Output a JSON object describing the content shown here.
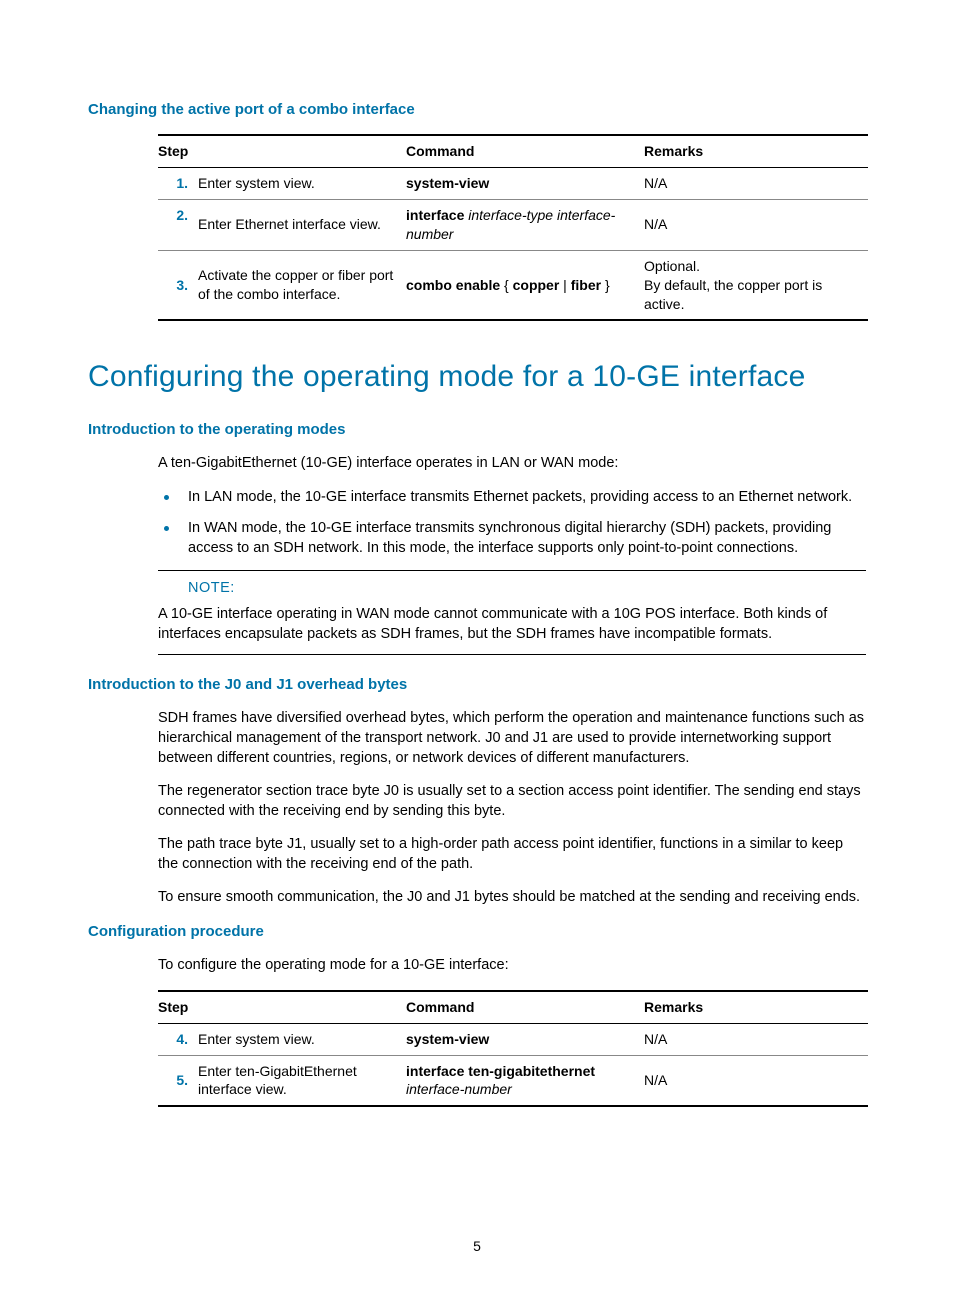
{
  "section1": {
    "title": "Changing the active port of a combo interface",
    "table": {
      "headers": {
        "step": "Step",
        "command": "Command",
        "remarks": "Remarks"
      },
      "rows": [
        {
          "num": "1.",
          "step": "Enter system view.",
          "cmd_bold": "system-view",
          "cmd_italic": "",
          "remarks": "N/A"
        },
        {
          "num": "2.",
          "step": "Enter Ethernet interface view.",
          "cmd_bold": "interface",
          "cmd_italic": "interface-type interface-number",
          "remarks": "N/A"
        },
        {
          "num": "3.",
          "step": "Activate the copper or fiber port of the combo interface.",
          "cmd_full": "combo enable { copper | fiber }",
          "remarks_line1": "Optional.",
          "remarks_line2": "By default, the copper port is active."
        }
      ]
    }
  },
  "section2": {
    "title": "Configuring the operating mode for a 10-GE interface",
    "sub1": {
      "title": "Introduction to the operating modes",
      "intro": "A ten-GigabitEthernet (10-GE) interface operates in LAN or WAN mode:",
      "bullets": [
        "In LAN mode, the 10-GE interface transmits Ethernet packets, providing access to an Ethernet network.",
        "In WAN mode, the 10-GE interface transmits synchronous digital hierarchy (SDH) packets, providing access to an SDH network. In this mode, the interface supports only point-to-point connections."
      ],
      "note_label": "NOTE:",
      "note_text": "A 10-GE interface operating in WAN mode cannot communicate with a 10G POS interface. Both kinds of interfaces encapsulate packets as SDH frames, but the SDH frames have incompatible formats."
    },
    "sub2": {
      "title": "Introduction to the J0 and J1 overhead bytes",
      "p1": "SDH frames have diversified overhead bytes, which perform the operation and maintenance functions such as hierarchical management of the transport network. J0 and J1 are used to provide internetworking support between different countries, regions, or network devices of different manufacturers.",
      "p2": "The regenerator section trace byte J0 is usually set to a section access point identifier. The sending end stays connected with the receiving end by sending this byte.",
      "p3": "The path trace byte J1, usually set to a high-order path access point identifier, functions in a similar to keep the connection with the receiving end of the path.",
      "p4": "To ensure smooth communication, the J0 and J1 bytes should be matched at the sending and receiving ends."
    },
    "sub3": {
      "title": "Configuration procedure",
      "intro": "To configure the operating mode for a 10-GE interface:",
      "table": {
        "headers": {
          "step": "Step",
          "command": "Command",
          "remarks": "Remarks"
        },
        "rows": [
          {
            "num": "4.",
            "step": "Enter system view.",
            "cmd_bold": "system-view",
            "cmd_italic": "",
            "remarks": "N/A"
          },
          {
            "num": "5.",
            "step": "Enter ten-GigabitEthernet interface view.",
            "cmd_bold": "interface ten-gigabitethernet",
            "cmd_italic": "interface-number",
            "remarks": "N/A"
          }
        ]
      }
    }
  },
  "page_number": "5"
}
